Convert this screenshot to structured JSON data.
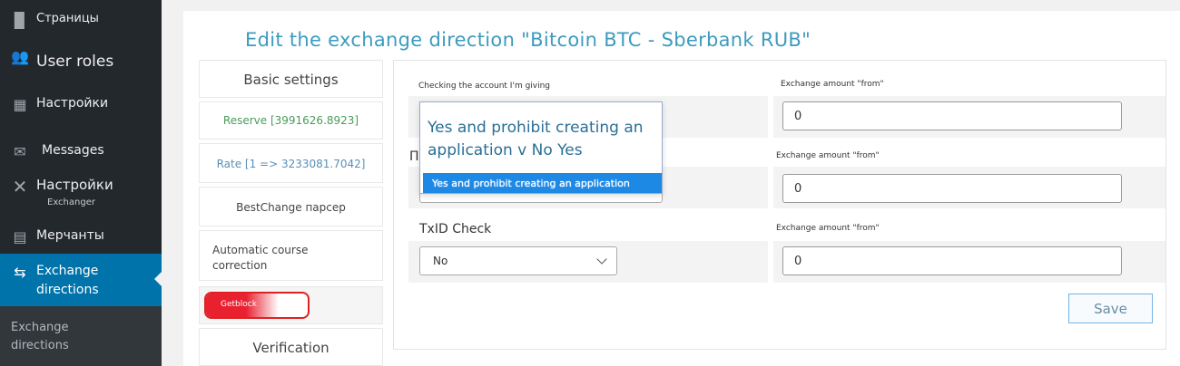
{
  "sidebar": {
    "items": [
      {
        "label": "Страницы",
        "icon": "pages-icon"
      },
      {
        "label": "User roles",
        "icon": "users-icon"
      },
      {
        "label": "Настройки",
        "icon": "settings-icon"
      },
      {
        "label": "Messages",
        "icon": "mail-icon"
      },
      {
        "label": "Настройки",
        "sublabel": "Exchanger",
        "icon": "tools-icon"
      },
      {
        "label": "Мерчанты",
        "icon": "merchants-icon"
      },
      {
        "label": "Exchange directions",
        "icon": "exchange-icon"
      }
    ],
    "submenu_label": "Exchange directions"
  },
  "page": {
    "title": "Edit the exchange direction \"Bitcoin BTC - Sberbank RUB\""
  },
  "tabs": [
    {
      "label": "Basic settings"
    },
    {
      "label": "Reserve [3991626.8923]"
    },
    {
      "label": "Rate [1 => 3233081.7042]"
    },
    {
      "label": "BestChange парсер"
    },
    {
      "label": "Automatic course correction"
    },
    {
      "label": "Getblock"
    },
    {
      "label": "Verification"
    }
  ],
  "settings": {
    "row1_label": "Checking the account I'm giving",
    "row2_label_partial": "П",
    "row3_label": "TxID Check",
    "row3_select_value": "No",
    "amount_label": "Exchange amount \"from\"",
    "amount_values": [
      "0",
      "0",
      "0"
    ],
    "save_label": "Save"
  },
  "popup": {
    "text": "Yes and prohibit creating an application v No Yes",
    "highlighted_option": "Yes and prohibit creating an application"
  },
  "colors": {
    "sidebar_bg": "#23282d",
    "active_bg": "#0073aa",
    "title": "#3d9bbf",
    "highlight": "#1e88e5",
    "getblock_red": "#e02020"
  }
}
